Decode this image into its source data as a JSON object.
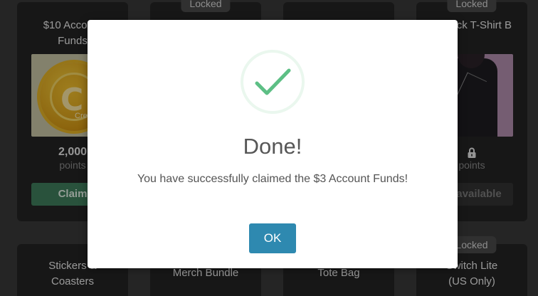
{
  "rewards": [
    {
      "title": "$10 Account\nFunds",
      "image_label": "Credit",
      "points": "2,000",
      "points_unit": "points",
      "button_label": "Claim",
      "locked_badge": ""
    },
    {
      "title": "",
      "locked_badge": "Locked"
    },
    {
      "title": "",
      "locked_badge": ""
    },
    {
      "title": "Black T-Shirt B",
      "points_unit": "points",
      "button_label": "Unavailable",
      "locked_badge": "Locked"
    },
    {
      "title": "Stickers &\nCoasters",
      "locked_badge": ""
    },
    {
      "title": "Merch Bundle",
      "locked_badge": ""
    },
    {
      "title": "Tote Bag",
      "locked_badge": ""
    },
    {
      "title": "Switch Lite\n(US Only)",
      "locked_badge": "Locked"
    }
  ],
  "modal": {
    "title": "Done!",
    "message": "You have successfully claimed the $3 Account Funds!",
    "ok_label": "OK",
    "icon": "success-checkmark-icon"
  },
  "colors": {
    "page_bg": "#3a3a3a",
    "card_bg": "#242424",
    "claim_button": "#3f7f5c",
    "ok_button": "#2e89b0",
    "check_green": "#5dbf85",
    "check_ring": "#eaf7ee"
  }
}
